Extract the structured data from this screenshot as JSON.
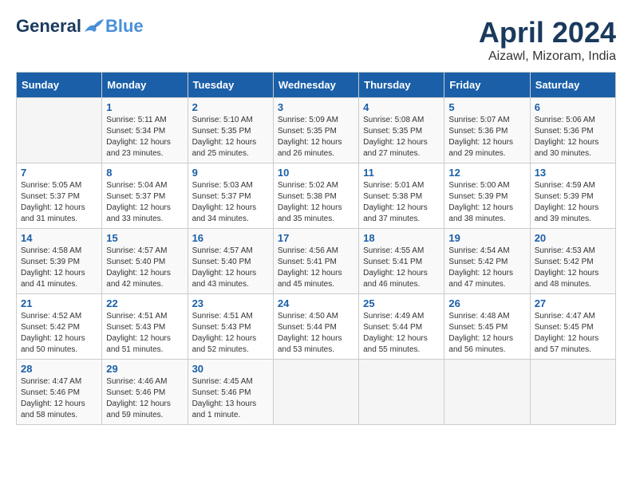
{
  "header": {
    "logo_general": "General",
    "logo_blue": "Blue",
    "title": "April 2024",
    "location": "Aizawl, Mizoram, India"
  },
  "calendar": {
    "days_of_week": [
      "Sunday",
      "Monday",
      "Tuesday",
      "Wednesday",
      "Thursday",
      "Friday",
      "Saturday"
    ],
    "weeks": [
      [
        {
          "day": "",
          "info": ""
        },
        {
          "day": "1",
          "info": "Sunrise: 5:11 AM\nSunset: 5:34 PM\nDaylight: 12 hours\nand 23 minutes."
        },
        {
          "day": "2",
          "info": "Sunrise: 5:10 AM\nSunset: 5:35 PM\nDaylight: 12 hours\nand 25 minutes."
        },
        {
          "day": "3",
          "info": "Sunrise: 5:09 AM\nSunset: 5:35 PM\nDaylight: 12 hours\nand 26 minutes."
        },
        {
          "day": "4",
          "info": "Sunrise: 5:08 AM\nSunset: 5:35 PM\nDaylight: 12 hours\nand 27 minutes."
        },
        {
          "day": "5",
          "info": "Sunrise: 5:07 AM\nSunset: 5:36 PM\nDaylight: 12 hours\nand 29 minutes."
        },
        {
          "day": "6",
          "info": "Sunrise: 5:06 AM\nSunset: 5:36 PM\nDaylight: 12 hours\nand 30 minutes."
        }
      ],
      [
        {
          "day": "7",
          "info": "Sunrise: 5:05 AM\nSunset: 5:37 PM\nDaylight: 12 hours\nand 31 minutes."
        },
        {
          "day": "8",
          "info": "Sunrise: 5:04 AM\nSunset: 5:37 PM\nDaylight: 12 hours\nand 33 minutes."
        },
        {
          "day": "9",
          "info": "Sunrise: 5:03 AM\nSunset: 5:37 PM\nDaylight: 12 hours\nand 34 minutes."
        },
        {
          "day": "10",
          "info": "Sunrise: 5:02 AM\nSunset: 5:38 PM\nDaylight: 12 hours\nand 35 minutes."
        },
        {
          "day": "11",
          "info": "Sunrise: 5:01 AM\nSunset: 5:38 PM\nDaylight: 12 hours\nand 37 minutes."
        },
        {
          "day": "12",
          "info": "Sunrise: 5:00 AM\nSunset: 5:39 PM\nDaylight: 12 hours\nand 38 minutes."
        },
        {
          "day": "13",
          "info": "Sunrise: 4:59 AM\nSunset: 5:39 PM\nDaylight: 12 hours\nand 39 minutes."
        }
      ],
      [
        {
          "day": "14",
          "info": "Sunrise: 4:58 AM\nSunset: 5:39 PM\nDaylight: 12 hours\nand 41 minutes."
        },
        {
          "day": "15",
          "info": "Sunrise: 4:57 AM\nSunset: 5:40 PM\nDaylight: 12 hours\nand 42 minutes."
        },
        {
          "day": "16",
          "info": "Sunrise: 4:57 AM\nSunset: 5:40 PM\nDaylight: 12 hours\nand 43 minutes."
        },
        {
          "day": "17",
          "info": "Sunrise: 4:56 AM\nSunset: 5:41 PM\nDaylight: 12 hours\nand 45 minutes."
        },
        {
          "day": "18",
          "info": "Sunrise: 4:55 AM\nSunset: 5:41 PM\nDaylight: 12 hours\nand 46 minutes."
        },
        {
          "day": "19",
          "info": "Sunrise: 4:54 AM\nSunset: 5:42 PM\nDaylight: 12 hours\nand 47 minutes."
        },
        {
          "day": "20",
          "info": "Sunrise: 4:53 AM\nSunset: 5:42 PM\nDaylight: 12 hours\nand 48 minutes."
        }
      ],
      [
        {
          "day": "21",
          "info": "Sunrise: 4:52 AM\nSunset: 5:42 PM\nDaylight: 12 hours\nand 50 minutes."
        },
        {
          "day": "22",
          "info": "Sunrise: 4:51 AM\nSunset: 5:43 PM\nDaylight: 12 hours\nand 51 minutes."
        },
        {
          "day": "23",
          "info": "Sunrise: 4:51 AM\nSunset: 5:43 PM\nDaylight: 12 hours\nand 52 minutes."
        },
        {
          "day": "24",
          "info": "Sunrise: 4:50 AM\nSunset: 5:44 PM\nDaylight: 12 hours\nand 53 minutes."
        },
        {
          "day": "25",
          "info": "Sunrise: 4:49 AM\nSunset: 5:44 PM\nDaylight: 12 hours\nand 55 minutes."
        },
        {
          "day": "26",
          "info": "Sunrise: 4:48 AM\nSunset: 5:45 PM\nDaylight: 12 hours\nand 56 minutes."
        },
        {
          "day": "27",
          "info": "Sunrise: 4:47 AM\nSunset: 5:45 PM\nDaylight: 12 hours\nand 57 minutes."
        }
      ],
      [
        {
          "day": "28",
          "info": "Sunrise: 4:47 AM\nSunset: 5:46 PM\nDaylight: 12 hours\nand 58 minutes."
        },
        {
          "day": "29",
          "info": "Sunrise: 4:46 AM\nSunset: 5:46 PM\nDaylight: 12 hours\nand 59 minutes."
        },
        {
          "day": "30",
          "info": "Sunrise: 4:45 AM\nSunset: 5:46 PM\nDaylight: 13 hours\nand 1 minute."
        },
        {
          "day": "",
          "info": ""
        },
        {
          "day": "",
          "info": ""
        },
        {
          "day": "",
          "info": ""
        },
        {
          "day": "",
          "info": ""
        }
      ]
    ]
  }
}
